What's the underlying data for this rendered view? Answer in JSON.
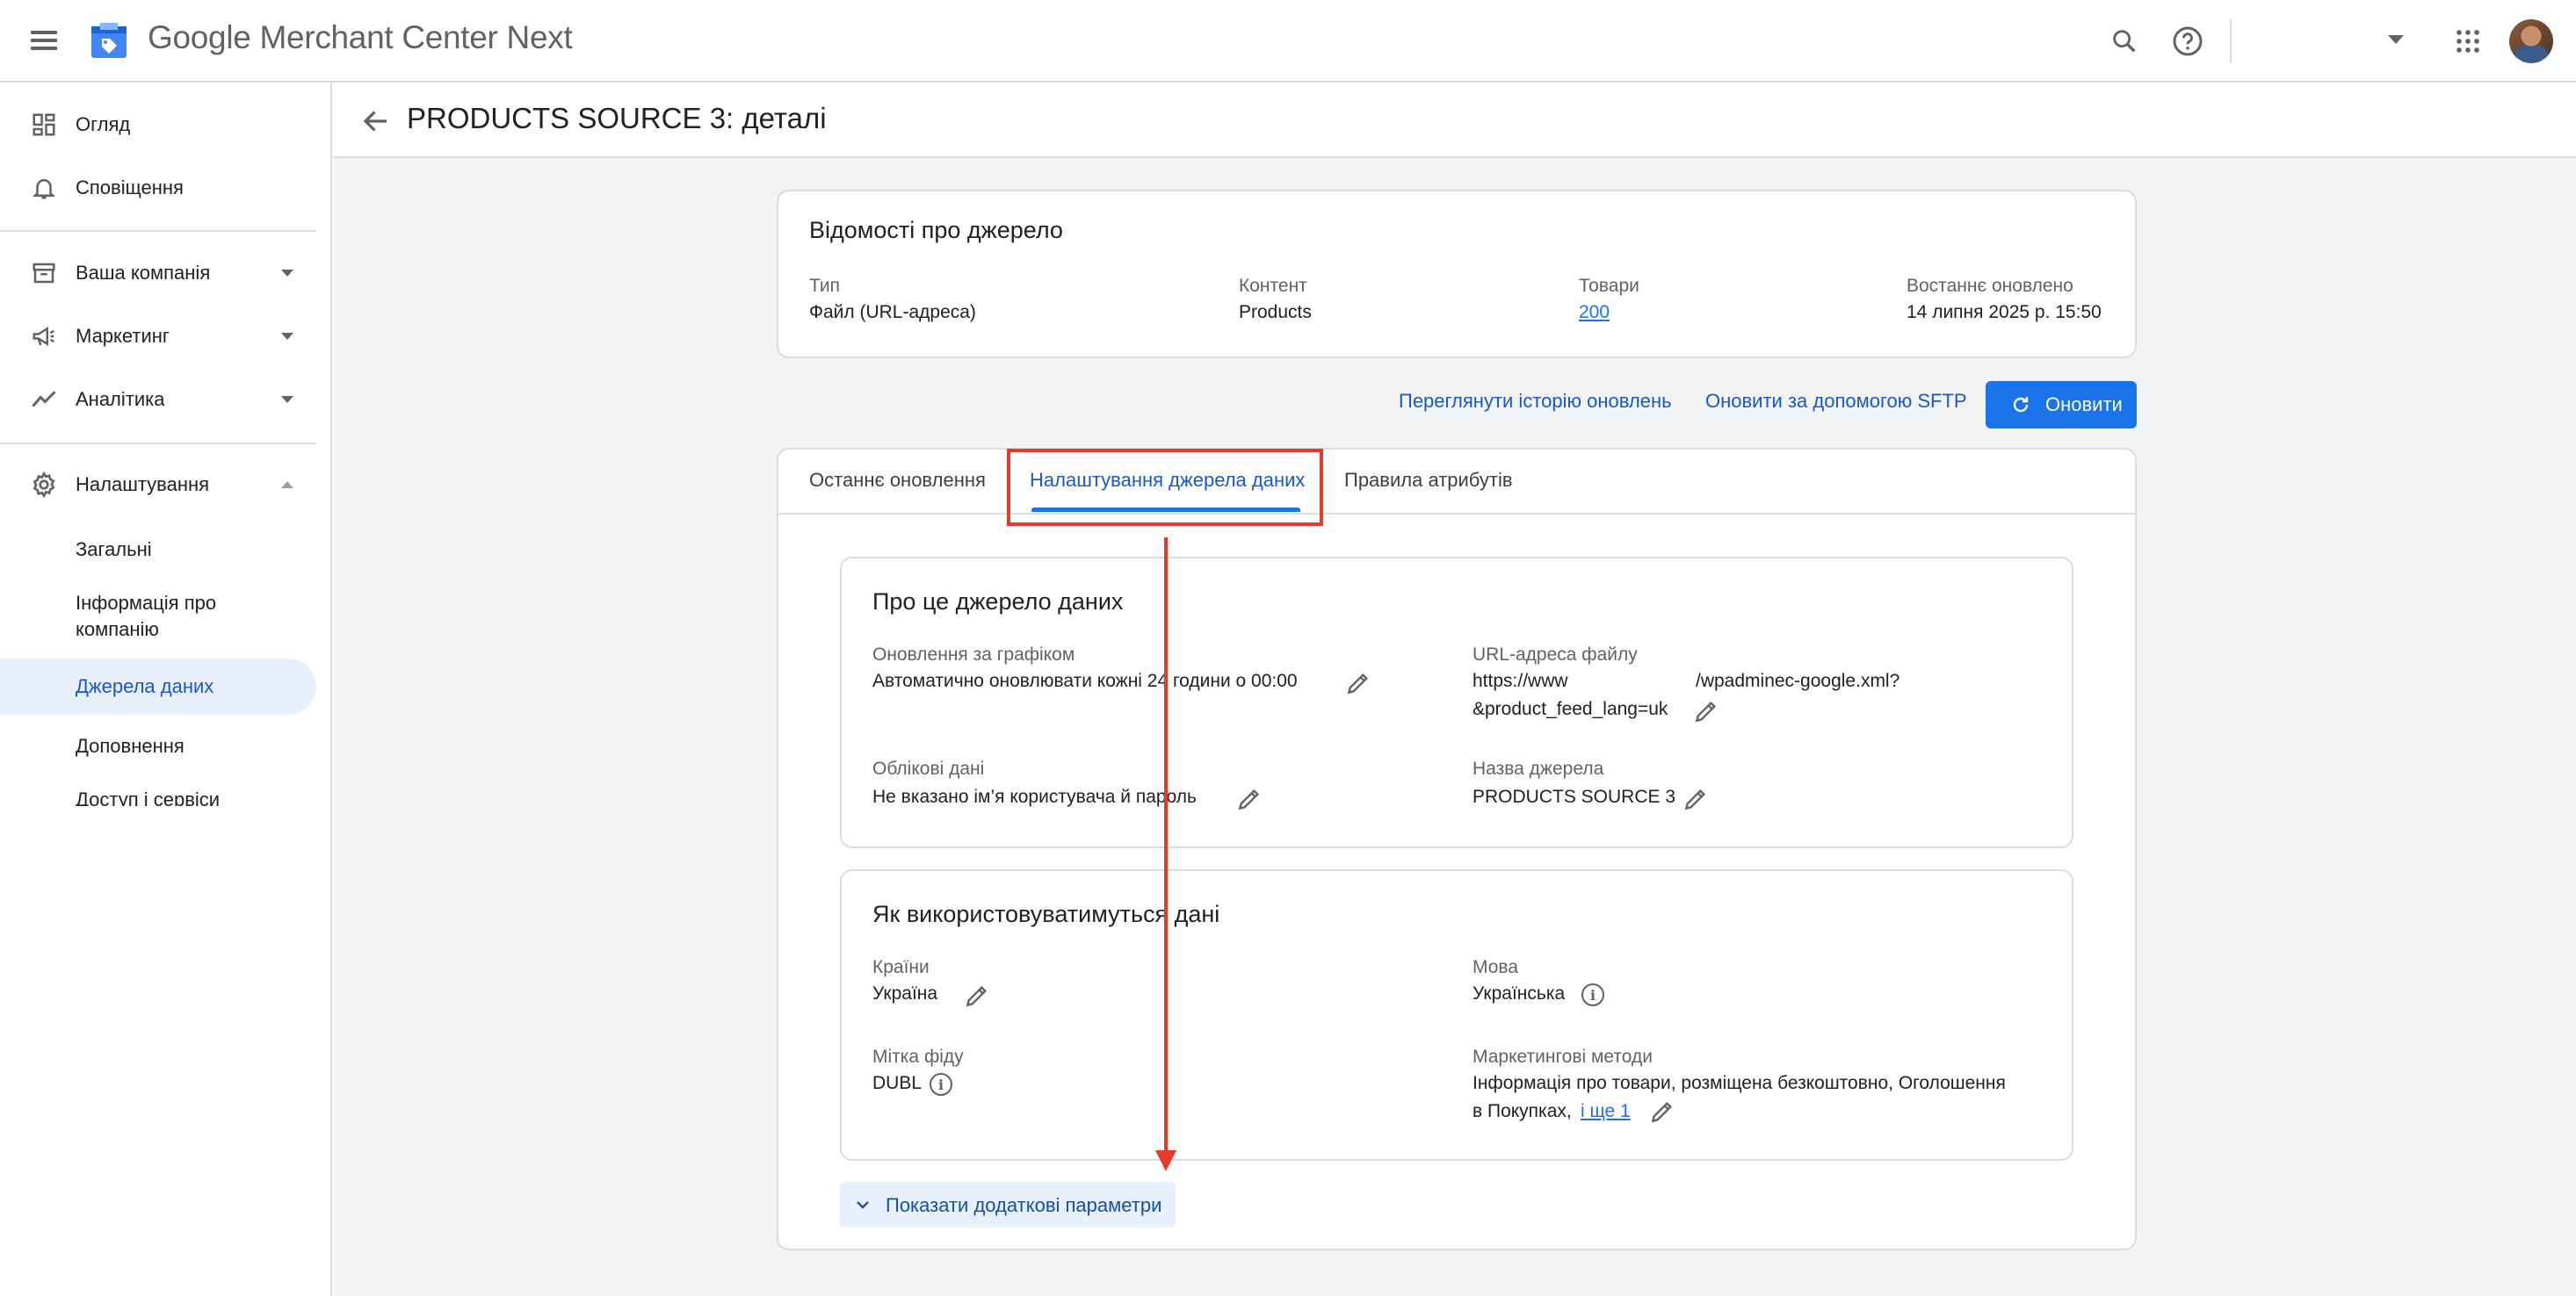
{
  "app": {
    "brand_prefix": "Google",
    "brand_name": "Merchant Center Next"
  },
  "sidebar": {
    "items": [
      {
        "label": "Огляд",
        "icon": "dashboard-icon"
      },
      {
        "label": "Сповіщення",
        "icon": "bell-icon"
      },
      {
        "label": "Ваша компанія",
        "icon": "store-icon"
      },
      {
        "label": "Маркетинг",
        "icon": "megaphone-icon"
      },
      {
        "label": "Аналітика",
        "icon": "trending-icon"
      },
      {
        "label": "Налаштування",
        "icon": "gear-icon"
      }
    ],
    "sub_items": [
      {
        "label": "Загальні"
      },
      {
        "label": "Інформація про компанію"
      },
      {
        "label": "Джерела даних"
      },
      {
        "label": "Доповнення"
      },
      {
        "label": "Доступ і сервіси"
      }
    ]
  },
  "page": {
    "title": "PRODUCTS SOURCE 3: деталі"
  },
  "source_info": {
    "title": "Відомості про джерело",
    "type_label": "Тип",
    "type_value": "Файл (URL-адреса)",
    "content_label": "Контент",
    "content_value": "Products",
    "products_label": "Товари",
    "products_value": "200",
    "updated_label": "Востаннє оновлено",
    "updated_value": "14 липня 2025 р. 15:50"
  },
  "actions": {
    "history_link": "Переглянути історію оновлень",
    "sftp_link": "Оновити за допомогою SFTP",
    "update_button": "Оновити"
  },
  "tabs": [
    {
      "label": "Останнє оновлення"
    },
    {
      "label": "Налаштування джерела даних"
    },
    {
      "label": "Правила атрибутів"
    }
  ],
  "about": {
    "title": "Про це джерело даних",
    "schedule_label": "Оновлення за графіком",
    "schedule_value": "Автоматично оновлювати кожні 24 години о 00:00",
    "url_label": "URL-адреса файлу",
    "url_value_line1_start": "https://www",
    "url_value_line1_end": "/wpadminec-google.xml?",
    "url_value_line2": "&product_feed_lang=uk",
    "credentials_label": "Облікові дані",
    "credentials_value": "Не вказано ім’я користувача й пароль",
    "name_label": "Назва джерела",
    "name_value": "PRODUCTS SOURCE 3"
  },
  "usage": {
    "title": "Як використовуватимуться дані",
    "countries_label": "Країни",
    "countries_value": "Україна",
    "language_label": "Мова",
    "language_value": "Українська",
    "feed_label_label": "Мітка фіду",
    "feed_label_value": "DUBL",
    "marketing_label": "Маркетингові методи",
    "marketing_value_line1": "Інформація про товари, розміщена безкоштовно, Оголошення",
    "marketing_value_line2": "в Покупках,",
    "marketing_more_link": "і ще 1"
  },
  "show_more": {
    "label": "Показати додаткові параметри"
  },
  "colors": {
    "accent": "#1a73e8",
    "annotation_red": "#e43b2b",
    "active_nav_bg": "#e8f0fe"
  }
}
